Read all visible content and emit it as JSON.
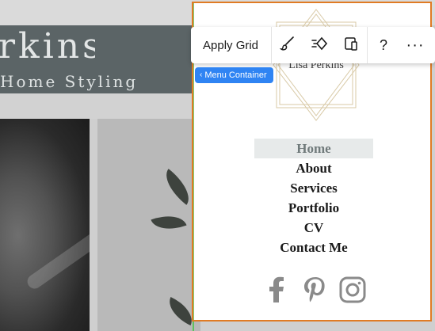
{
  "background_site": {
    "title_partial": "rkins",
    "subtitle_partial": "Home Styling"
  },
  "logo": {
    "name": "Lisa Perkins"
  },
  "menu": {
    "items": [
      {
        "label": "Home",
        "active": true
      },
      {
        "label": "About",
        "active": false
      },
      {
        "label": "Services",
        "active": false
      },
      {
        "label": "Portfolio",
        "active": false
      },
      {
        "label": "CV",
        "active": false
      },
      {
        "label": "Contact Me",
        "active": false
      }
    ]
  },
  "social": {
    "icons": [
      "facebook-icon",
      "pinterest-icon",
      "instagram-icon"
    ],
    "color": "#8a8a8a"
  },
  "toolbar": {
    "apply_grid_label": "Apply Grid",
    "help_label": "?",
    "more_label": "···",
    "icons": [
      "brush-icon",
      "animation-icon",
      "layout-icon",
      "help-icon",
      "more-icon"
    ]
  },
  "breadcrumb": {
    "label": "Menu Container",
    "chevron": "‹"
  },
  "colors": {
    "selection_border": "#e07b24",
    "tag_background": "#2f84f3",
    "active_menu_background": "#e7eaea",
    "logo_line": "#d8c9a6"
  }
}
